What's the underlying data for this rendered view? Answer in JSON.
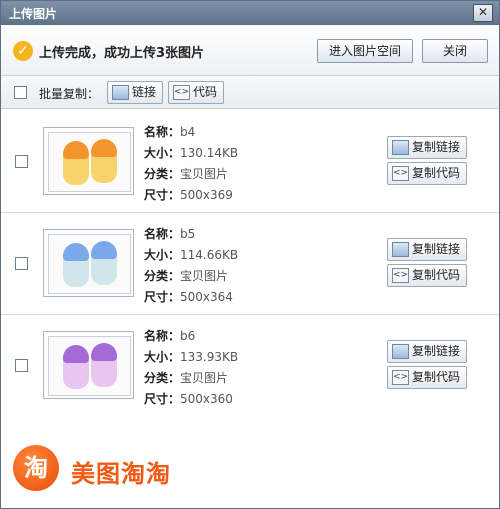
{
  "window": {
    "title": "上传图片"
  },
  "status": {
    "message": "上传完成，成功上传3张图片"
  },
  "header_buttons": {
    "enter_space": "进入图片空间",
    "close": "关闭"
  },
  "toolbar": {
    "batch_copy": "批量复制：",
    "link": "链接",
    "code": "代码"
  },
  "meta_labels": {
    "name": "名称：",
    "size": "大小：",
    "category": "分类：",
    "dimensions": "尺寸："
  },
  "item_buttons": {
    "copy_link": "复制链接",
    "copy_code": "复制代码"
  },
  "images": [
    {
      "name": "b4",
      "size": "130.14KB",
      "category": "宝贝图片",
      "dimensions": "500x369",
      "color": "#f3952e"
    },
    {
      "name": "b5",
      "size": "114.66KB",
      "category": "宝贝图片",
      "dimensions": "500x364",
      "color": "#7aa8e8"
    },
    {
      "name": "b6",
      "size": "133.93KB",
      "category": "宝贝图片",
      "dimensions": "500x360",
      "color": "#a56ad6"
    }
  ],
  "brand": {
    "icon_char": "淘",
    "name": "美图淘淘"
  },
  "colors": {
    "titlebar": "#6b8096",
    "brand": "#f05a12",
    "check": "#f4b521"
  }
}
